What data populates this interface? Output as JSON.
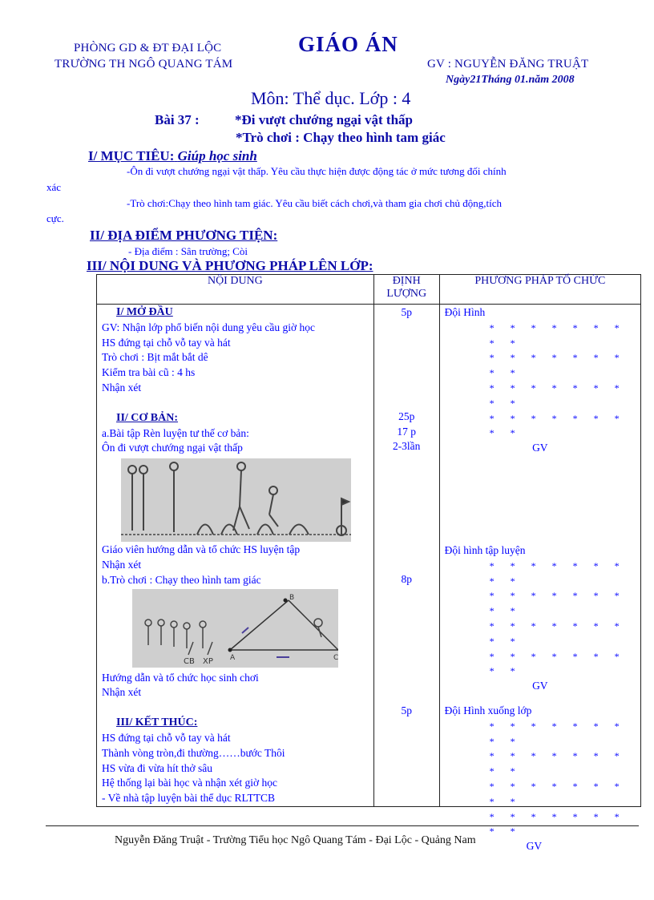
{
  "header": {
    "department": "PHÒNG GD & ĐT  ĐẠI LỘC",
    "school": "TRƯỜNG TH  NGÔ QUANG TÁM",
    "doc_title": "GIÁO  ÁN",
    "teacher": "GV : NGUYỄN ĐĂNG TRUẬT",
    "date": "Ngày21Tháng 01.năm 2008"
  },
  "subject_line": "Môn: Thể dục.    Lớp : 4",
  "lesson": {
    "label": "Bài  37 :",
    "topic1": "*Đi vượt chướng ngại vật thấp",
    "topic2": "*Trò chơi : Chạy theo hình tam giác"
  },
  "section1": {
    "heading": "I/ MỤC TIÊU:",
    "heading_italic": "Giúp học sinh",
    "line1a": "-Ôn đi vượt chướng  ngại  vật thấp. Yêu  cầu thực hiện  được động tác ở mức tương  đối chính",
    "line1b": "xác",
    "line2a": "-Trò chơi:Chạy   theo hình  tam giác. Yêu  cầu biết cách chơi,và  tham  gia  chơi  chủ  động,tích",
    "line2b": "cực."
  },
  "section2": {
    "heading": "II/ ĐỊA ĐIỂM PHƯƠNG TIỆN:",
    "line": "-     Địa điểm  : Sân trường;    Còi"
  },
  "section3": {
    "heading": "III/ NỘI DUNG VÀ PHƯƠNG PHÁP LÊN LỚP:"
  },
  "table": {
    "headers": {
      "content": "NỘI DUNG",
      "amount_line1": "ĐỊNH",
      "amount_line2": "LƯỢNG",
      "method": "PHƯƠNG  PHÁP  TỔ  CHỨC"
    },
    "part1": {
      "title": "I/ MỞ ĐẦU",
      "lines": [
        "GV: Nhận lớp phổ biến nội dung yêu cầu giờ học",
        "HS đứng tại chỗ vỗ tay và hát",
        "Trò chơi : Bịt mắt bắt dê",
        "Kiểm tra bài cũ :  4  hs",
        " Nhận xét"
      ],
      "amount": "5p",
      "method_label": "Đội Hình",
      "star_rows": [
        "* * * * * * * * *",
        "* * * * * * * * *",
        "* * * * * * * * *",
        "* * * * * * * * *"
      ],
      "gv": "GV"
    },
    "part2": {
      "title": "II/ CƠ BẢN:",
      "lines_a": [
        "a.Bài tập Rèn luyện  tư thế  cơ bản:",
        "Ôn đi vượt chướng  ngại  vật thấp"
      ],
      "amounts_a": [
        "25p",
        "17 p",
        "2-3lần"
      ],
      "image1_alt": "Minh họa học sinh đi vượt chướng ngại vật thấp",
      "lines_b": [
        "Giáo  viên  hướng  dẫn và tổ chức HS luyện  tập",
        "Nhận xét",
        "b.Trò chơi  : Chạy theo hình  tam giác"
      ],
      "amount_b": "8p",
      "image2_alt": "Sơ đồ trò chơi chạy theo hình tam giác",
      "image2_labels": {
        "b": "B",
        "a": "A",
        "c": "C",
        "cb": "CB",
        "xp": "XP"
      },
      "lines_c": [
        "Hướng  dẫn và tổ chức học sinh  chơi",
        " Nhận xét"
      ],
      "method_label": "Đội hình  tập luyện",
      "star_rows": [
        "* * * * * * * * *",
        "* * * * * * * * *",
        "* * * * * * * * *",
        "* * * * * * * * *"
      ],
      "gv": "GV"
    },
    "part3": {
      "title": "III/ KẾT THÚC:",
      "lines": [
        "HS đứng tại chỗ vỗ tay và hát",
        "Thành  vòng tròn,đi thường……bước          Thôi",
        "HS vừa đi vừa hít thở sâu",
        "Hệ thống lại bài học và nhận xét giờ  học",
        "- Về nhà tập luyện  bài thể dục RLTTCB"
      ],
      "amount": "5p",
      "method_label": "Đội Hình  xuống  lớp",
      "star_rows": [
        "* * * * * * * * *",
        "* * * * * * * * *",
        "* * * * * * * * *",
        "* * * * * * * * *"
      ],
      "gv": "GV"
    }
  },
  "footer": "Nguyễn  Đăng Truật  - Trường  Tiểu  học Ngô Quang Tám  - Đại Lộc - Quảng  Nam"
}
